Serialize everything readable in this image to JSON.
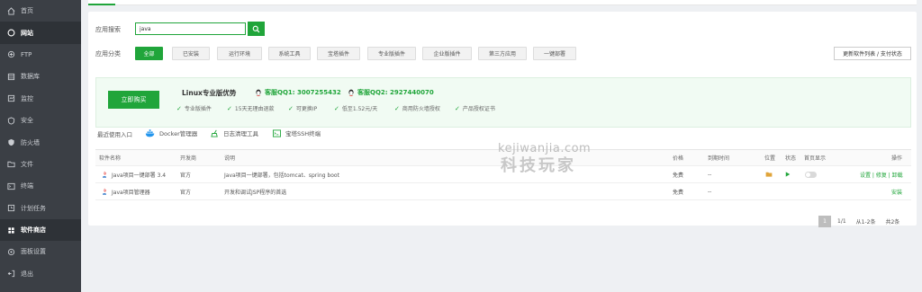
{
  "sidebar": {
    "items": [
      {
        "label": "首页",
        "icon": "home-icon"
      },
      {
        "label": "网站",
        "icon": "globe-icon"
      },
      {
        "label": "FTP",
        "icon": "ftp-icon"
      },
      {
        "label": "数据库",
        "icon": "database-icon"
      },
      {
        "label": "监控",
        "icon": "monitor-icon"
      },
      {
        "label": "安全",
        "icon": "shield-icon"
      },
      {
        "label": "防火墙",
        "icon": "firewall-icon"
      },
      {
        "label": "文件",
        "icon": "folder-icon"
      },
      {
        "label": "终端",
        "icon": "terminal-icon"
      },
      {
        "label": "计划任务",
        "icon": "clock-icon"
      },
      {
        "label": "软件商店",
        "icon": "store-icon"
      },
      {
        "label": "面板设置",
        "icon": "settings-icon"
      },
      {
        "label": "退出",
        "icon": "logout-icon"
      }
    ]
  },
  "search": {
    "label": "应用搜索",
    "value": "java"
  },
  "categories": {
    "label": "应用分类",
    "items": [
      "全部",
      "已安装",
      "运行环境",
      "系统工具",
      "宝塔插件",
      "专业版插件",
      "企业版插件",
      "第三方应用",
      "一键部署"
    ],
    "active": "全部"
  },
  "update_button": "更新软件列表 / 支付状态",
  "promo": {
    "buy_label": "立即购买",
    "title": "Linux专业版优势",
    "qq1": "客服QQ1: 3007255432",
    "qq2": "客服QQ2: 2927440070",
    "features": [
      "专业版插件",
      "15天无理由退款",
      "可更换IP",
      "低至1.52元/天",
      "商用防火墙授权",
      "产品授权证书"
    ]
  },
  "tools": {
    "label": "最近使用入口",
    "items": [
      "Docker管理器",
      "日志清理工具",
      "宝塔SSH终端"
    ]
  },
  "watermark": {
    "line1": "kejiwanjia.com",
    "line2": "科技玩家"
  },
  "table": {
    "headers": {
      "name": "软件名称",
      "developer": "开发商",
      "desc": "说明",
      "price": "价格",
      "expire": "到期时间",
      "location": "位置",
      "status": "状态",
      "home": "首页显示",
      "ops": "操作"
    },
    "rows": [
      {
        "name": "Java项目一键部署 3.4",
        "developer": "官方",
        "desc": "Java项目一键部署，包括tomcat、spring boot",
        "price": "免费",
        "expire": "--",
        "ops": "设置 | 修复 | 卸载"
      },
      {
        "name": "Java项目管理器",
        "developer": "官方",
        "desc": "开发和调试JSP程序的首选",
        "price": "免费",
        "expire": "--",
        "ops": "安装"
      }
    ]
  },
  "pager": {
    "current": "1",
    "pages": "1/1",
    "range": "从1-2条",
    "total": "共2条"
  },
  "colors": {
    "accent": "#20a53a",
    "sidebar": "#3b3f45"
  }
}
